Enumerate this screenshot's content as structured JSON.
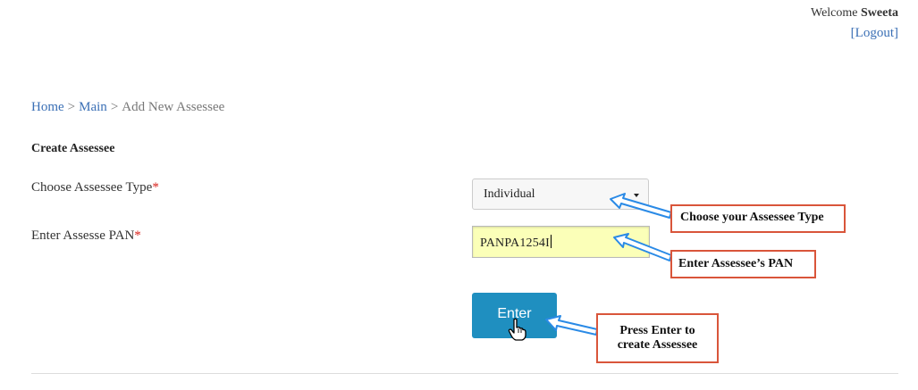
{
  "header": {
    "welcome_prefix": "Welcome",
    "user_name": "Sweeta",
    "logout_label": "[Logout]"
  },
  "breadcrumb": {
    "home": "Home",
    "separator": ">",
    "main": "Main",
    "current": "Add New Assessee"
  },
  "form": {
    "title": "Create Assessee",
    "assessee_type_label": "Choose Assessee Type",
    "pan_label": "Enter Assesse PAN",
    "required_mark": "*",
    "assessee_type_value": "Individual",
    "pan_value": "PANPA1254I",
    "submit_label": "Enter"
  },
  "callouts": {
    "type_hint": "Choose your Assessee Type",
    "pan_hint": "Enter Assessee’s PAN",
    "enter_hint_line1": "Press Enter to",
    "enter_hint_line2": "create Assessee"
  },
  "colors": {
    "link": "#3a6fb5",
    "required": "#d9221c",
    "button": "#1f8fc0",
    "input_highlight": "#fbffb8",
    "callout_border": "#d9553a",
    "arrow": "#2a8ae6"
  },
  "icons": {
    "cursor": "hand-pointer-icon",
    "dropdown": "caret-down-icon"
  }
}
